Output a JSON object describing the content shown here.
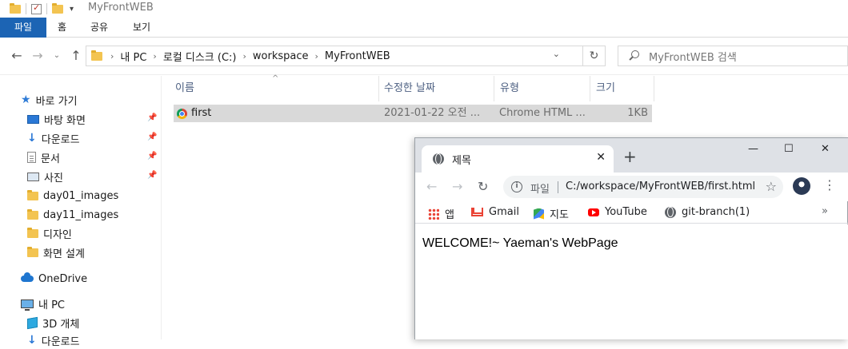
{
  "explorer": {
    "title": "MyFrontWEB",
    "ribbon_tabs": [
      "파일",
      "홈",
      "공유",
      "보기"
    ],
    "breadcrumb": [
      "내 PC",
      "로컬 디스크 (C:)",
      "workspace",
      "MyFrontWEB"
    ],
    "search_placeholder": "MyFrontWEB 검색",
    "nav": {
      "quick_access": "바로 가기",
      "items": [
        "바탕 화면",
        "다운로드",
        "문서",
        "사진",
        "day01_images",
        "day11_images",
        "디자인",
        "화면 설계"
      ],
      "onedrive": "OneDrive",
      "this_pc": "내 PC",
      "objects_3d": "3D 개체",
      "downloads_partial": "다운로드"
    },
    "columns": [
      "이름",
      "수정한 날짜",
      "유형",
      "크기"
    ],
    "files": [
      {
        "name": "first",
        "modified": "2021-01-22 오전 ...",
        "type": "Chrome HTML ...",
        "size": "1KB"
      }
    ]
  },
  "chrome": {
    "tab_title": "제목",
    "omnibox_label": "파일",
    "url": "C:/workspace/MyFrontWEB/first.html",
    "bookmarks": [
      "앱",
      "Gmail",
      "지도",
      "YouTube",
      "git-branch(1)"
    ],
    "page_text": "WELCOME!~ Yaeman's WebPage"
  },
  "colors": {
    "ribbon_file_tab": "#1c64b4",
    "selected_row": "#d9d9d9",
    "chrome_tabstrip": "#dee1e6"
  }
}
